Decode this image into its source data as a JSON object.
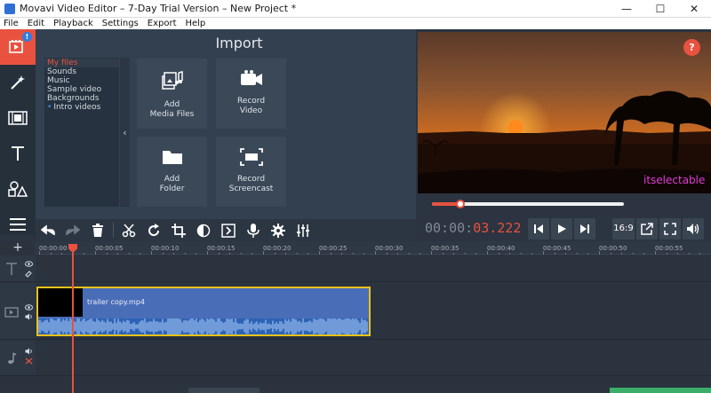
{
  "window": {
    "title": "Movavi Video Editor – 7-Day Trial Version – New Project *",
    "minimize": "—",
    "maximize": "☐",
    "close": "✕"
  },
  "menu": [
    "File",
    "Edit",
    "Playback",
    "Settings",
    "Export",
    "Help"
  ],
  "left_toolbar": {
    "badge": "!",
    "tools": [
      "import-icon",
      "magic-wand-icon",
      "film-transition-icon",
      "text-icon",
      "shapes-icon",
      "list-icon"
    ]
  },
  "import": {
    "title": "Import",
    "categories": [
      "My files",
      "Sounds",
      "Music",
      "Sample video",
      "Backgrounds",
      "Intro videos"
    ],
    "selected_category": "My files",
    "collapse_glyph": "‹",
    "tiles": [
      {
        "label": "Add\nMedia Files",
        "icon": "media-files-icon"
      },
      {
        "label": "Record\nVideo",
        "icon": "camera-icon"
      },
      {
        "label": "Add\nFolder",
        "icon": "folder-icon"
      },
      {
        "label": "Record\nScreencast",
        "icon": "screencast-icon"
      }
    ]
  },
  "preview": {
    "help": "?",
    "watermark": "itselectable",
    "progress": 0.15
  },
  "player": {
    "timecode_dim": "00:00:",
    "timecode_hot": "03.222",
    "ratio": "16:9"
  },
  "timeline": {
    "ticks": [
      "00:00:00",
      "00:00:05",
      "00:00:10",
      "00:00:15",
      "00:00:20",
      "00:00:25",
      "00:00:30",
      "00:00:35",
      "00:00:40",
      "00:00:45",
      "00:00:50",
      "00:00:55"
    ],
    "add": "+",
    "clip_name": "trailer copy.mp4"
  },
  "colors": {
    "accent": "#e8523f",
    "clip": "#4a6db8",
    "clip_border": "#e9c21b",
    "watermark": "#e339d8"
  }
}
